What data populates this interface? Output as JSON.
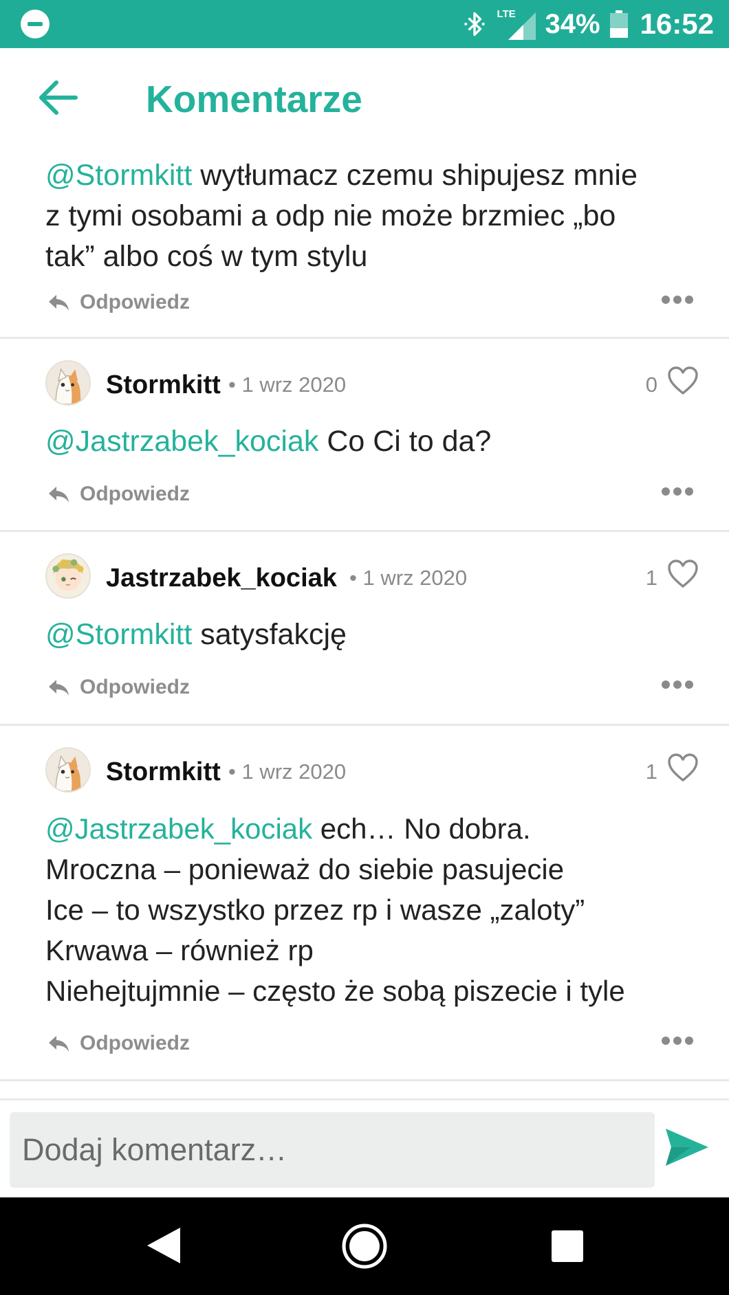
{
  "status_bar": {
    "network": "LTE",
    "battery": "34%",
    "time": "16:52"
  },
  "header": {
    "title": "Komentarze"
  },
  "comments": [
    {
      "mention": "@Stormkitt",
      "text": " wytłumacz czemu shipujesz mnie\nz tymi osobami a odp nie może brzmiec „bo\ntak” albo coś w tym stylu",
      "reply_label": "Odpowiedz"
    },
    {
      "username": "Stormkitt",
      "date": "• 1 wrz 2020",
      "likes": "0",
      "mention": "@Jastrzabek_kociak",
      "text": " Co Ci to da?",
      "reply_label": "Odpowiedz"
    },
    {
      "username": "Jastrzabek_kociak",
      "date": "• 1 wrz 2020",
      "likes": "1",
      "mention": "@Stormkitt",
      "text": " satysfakcję",
      "reply_label": "Odpowiedz"
    },
    {
      "username": "Stormkitt",
      "date": "• 1 wrz 2020",
      "likes": "1",
      "mention": "@Jastrzabek_kociak",
      "text": " ech… No dobra.\nMroczna – ponieważ do siebie pasujecie\nIce – to wszystko przez rp i wasze „zaloty”\nKrwawa – również rp\nNiehejtujmnie – często że sobą piszecie i tyle",
      "reply_label": "Odpowiedz"
    }
  ],
  "input": {
    "placeholder": "Dodaj komentarz…"
  },
  "colors": {
    "accent": "#24b29b",
    "status_bar": "#20ad97"
  },
  "icons": [
    "minus-circle-icon",
    "bluetooth-icon",
    "signal-icon",
    "battery-icon",
    "back-arrow-icon",
    "avatar-cat-icon",
    "avatar-chibi-icon",
    "heart-icon",
    "reply-icon",
    "more-icon",
    "send-icon",
    "nav-back-icon",
    "nav-home-icon",
    "nav-recent-icon"
  ]
}
